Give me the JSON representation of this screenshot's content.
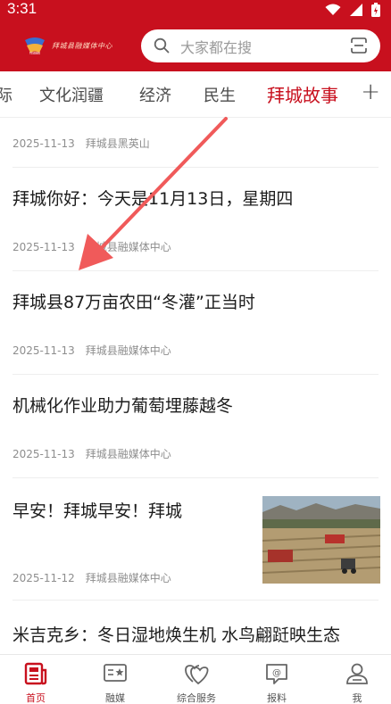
{
  "status": {
    "time": "3:31"
  },
  "header": {
    "logo_text": "拜城县融媒体中心",
    "search_placeholder": "大家都在搜"
  },
  "tabs": [
    {
      "label": "际"
    },
    {
      "label": "文化润疆"
    },
    {
      "label": "经济"
    },
    {
      "label": "民生"
    },
    {
      "label": "拜城故事",
      "active": true
    }
  ],
  "feed": {
    "items": [
      {
        "title": "",
        "date": "2025-11-13",
        "source": "拜城县黑英山"
      },
      {
        "title": "拜城你好：今天是11月13日，星期四",
        "date": "2025-11-13",
        "source": "拜城县融媒体中心"
      },
      {
        "title": "拜城县87万亩农田“冬灌”正当时",
        "date": "2025-11-13",
        "source": "拜城县融媒体中心"
      },
      {
        "title": "机械化作业助力葡萄埋藤越冬",
        "date": "2025-11-13",
        "source": "拜城县融媒体中心"
      },
      {
        "title": "早安！拜城早安！拜城",
        "date": "2025-11-12",
        "source": "拜城县融媒体中心",
        "has_image": true
      },
      {
        "title": "米吉克乡：冬日湿地焕生机 水鸟翩跹映生态",
        "date": "",
        "source": ""
      }
    ]
  },
  "bottom_nav": [
    {
      "label": "首页",
      "icon": "home-news-icon",
      "active": true
    },
    {
      "label": "融媒",
      "icon": "media-star-icon"
    },
    {
      "label": "综合服务",
      "icon": "heart-service-icon"
    },
    {
      "label": "报料",
      "icon": "report-chat-icon"
    },
    {
      "label": "我",
      "icon": "person-icon"
    }
  ],
  "colors": {
    "brand": "#c8101e",
    "annotation_arrow": "#f05a5a"
  }
}
